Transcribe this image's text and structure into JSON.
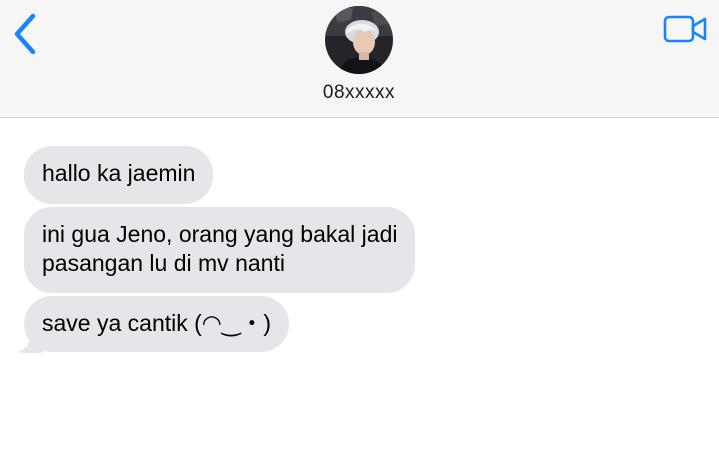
{
  "header": {
    "contact_name": "08xxxxx",
    "back_icon": "chevron-left-icon",
    "video_icon": "video-camera-icon",
    "accent_color": "#1a84ff"
  },
  "messages": [
    {
      "direction": "incoming",
      "lines": [
        "hallo ka jaemin"
      ]
    },
    {
      "direction": "incoming",
      "lines": [
        "ini gua Jeno, orang yang bakal jadi",
        "pasangan lu di mv nanti"
      ]
    },
    {
      "direction": "incoming",
      "lines": [
        "save ya cantik (◠‿・)"
      ]
    }
  ],
  "colors": {
    "incoming_bubble": "#e5e5ea",
    "header_background": "#f6f6f7"
  }
}
